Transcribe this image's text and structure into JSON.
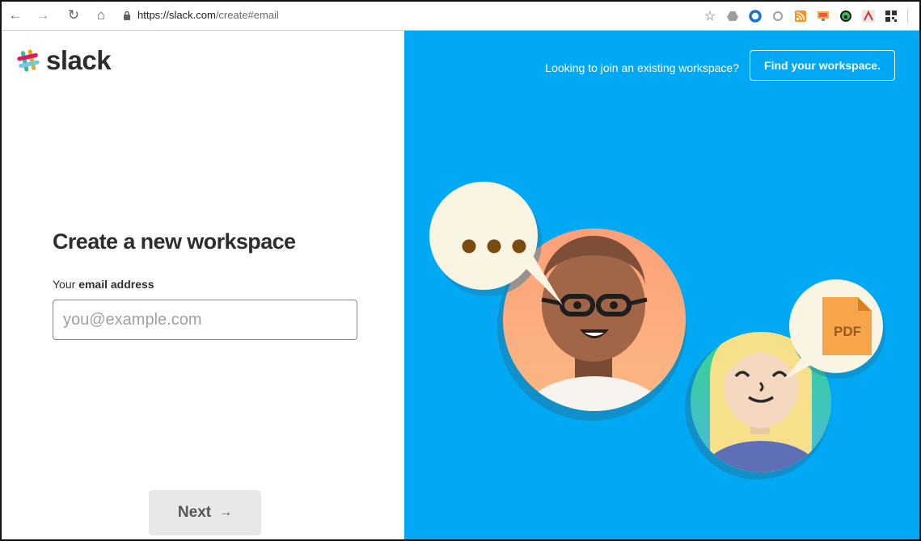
{
  "browser": {
    "url_host": "https://slack.com",
    "url_path": "/create#email",
    "icons": [
      "back-arrow-icon",
      "forward-arrow-icon",
      "reload-icon",
      "home-icon",
      "lock-icon",
      "star-icon"
    ]
  },
  "left": {
    "logo_text": "slack",
    "heading": "Create a new workspace",
    "label_prefix": "Your ",
    "label_bold": "email address",
    "email_placeholder": "you@example.com",
    "email_value": "",
    "next_label": "Next"
  },
  "right": {
    "join_text": "Looking to join an existing workspace?",
    "find_button": "Find your workspace.",
    "pdf_label": "PDF"
  },
  "colors": {
    "right_bg": "#01a9f4",
    "heading": "#2c2d30",
    "next_bg": "#e8e8e8"
  }
}
